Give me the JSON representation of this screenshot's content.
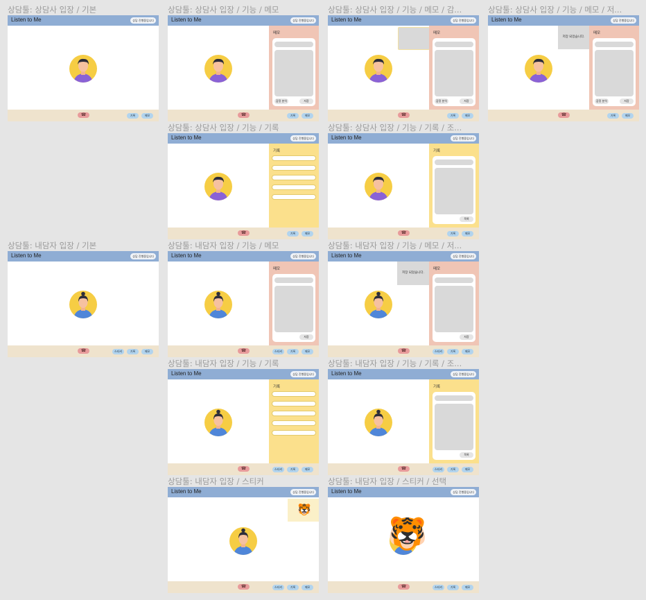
{
  "app_title": "Listen to Me",
  "status_pill": "상담 진행중입니다",
  "frame_titles": {
    "f1": "상담툴: 상담사 입장 / 기본",
    "f2": "상담툴: 상담사 입장 / 기능 / 메모",
    "f3": "상담툴: 상담사 입장 / 기능 / 메모 / 감...",
    "f4": "상담툴: 상담사 입장 / 기능 / 메모 / 저...",
    "f5": "상담툴: 상담사 입장 / 기능 / 기록",
    "f6": "상담툴: 상담사 입장 / 기능 / 기록 / 조...",
    "f7": "상담툴: 내담자 입장 / 기본",
    "f8": "상담툴: 내담자 입장 / 기능 / 메모",
    "f9": "상담툴: 내담자 입장 / 기능 / 메모 / 저...",
    "f10": "상담툴: 내담자 입장 / 기능 / 기록",
    "f11": "상담툴: 내담자 입장 / 기능 / 기록 / 조...",
    "f12": "상담툴: 내담자 입장 / 스티커",
    "f13": "상담툴: 내담자 입장 / 스티커 / 선택"
  },
  "footer": {
    "hangup_icon": "☎",
    "record_label": "기록",
    "memo_label": "메모",
    "sticker_label": "스티커"
  },
  "memo_panel": {
    "title": "메모",
    "emotion_btn": "감정 분석",
    "save_btn": "저장"
  },
  "record_panel": {
    "title": "기록",
    "back_btn": "목록"
  },
  "toast_saved": "저장 되었습니다.",
  "sticker_glyph": "🐯",
  "colors": {
    "header": "#8fadd4",
    "footer": "#efe3cd",
    "memo_panel": "#f0c5b5",
    "record_panel": "#fbe08c",
    "hangup": "#e89b9b",
    "footer_button": "#b2d4ee"
  }
}
